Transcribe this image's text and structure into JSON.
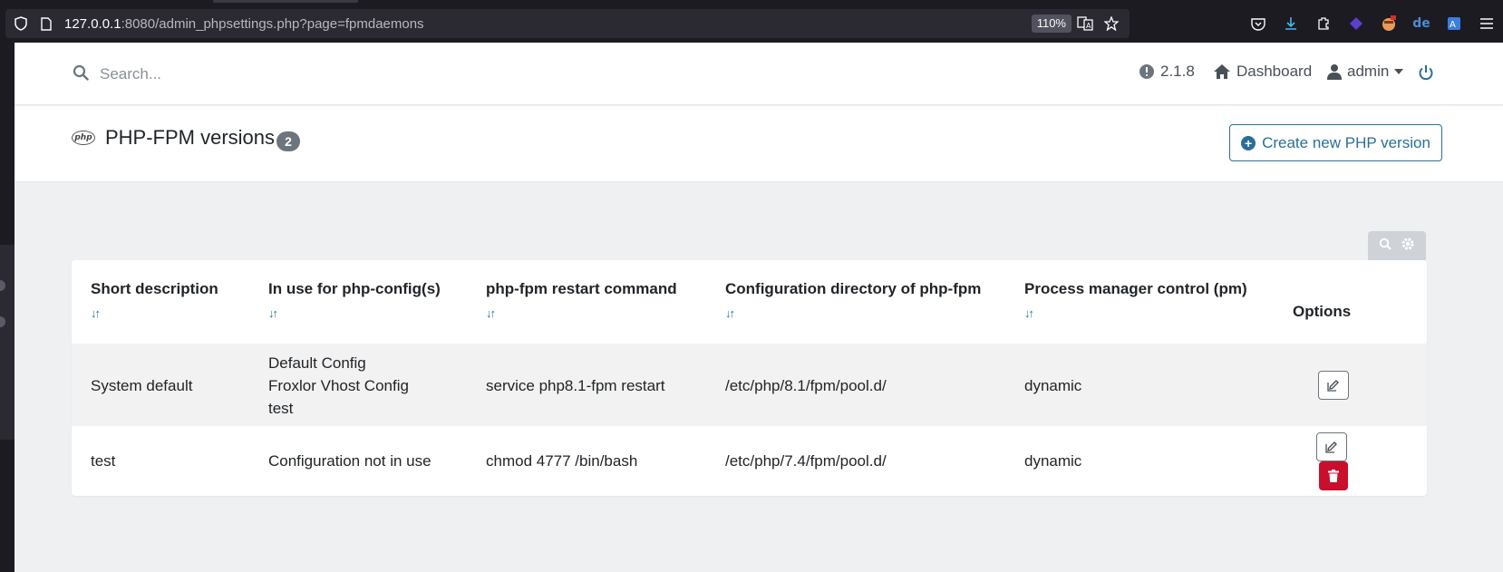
{
  "browser": {
    "url_host": "127.0.0.1",
    "url_rest": ":8080/admin_phpsettings.php?page=fpmdaemons",
    "zoom": "110%",
    "icons": [
      "shield-icon",
      "page-icon",
      "translate-icon",
      "bookmark-star-icon",
      "pocket-icon",
      "download-icon",
      "extensions-icon",
      "vpn-icon",
      "avatar-icon",
      "dict-de-icon",
      "translate-ext-icon",
      "menu-icon"
    ]
  },
  "nav": {
    "search_placeholder": "Search...",
    "version": "2.1.8",
    "dashboard": "Dashboard",
    "user": "admin"
  },
  "header": {
    "php_logo": "php",
    "title": "PHP-FPM versions",
    "count": "2",
    "create_button": "Create new PHP version"
  },
  "table": {
    "columns": [
      "Short description",
      "In use for php-config(s)",
      "php-fpm restart command",
      "Configuration directory of php-fpm",
      "Process manager control (pm)",
      "Options"
    ],
    "sort_glyph": "↓↑",
    "rows": [
      {
        "description": "System default",
        "configs": [
          "Default Config",
          "Froxlor Vhost Config",
          "test"
        ],
        "restart": "service php8.1-fpm restart",
        "dir": "/etc/php/8.1/fpm/pool.d/",
        "pm": "dynamic"
      },
      {
        "description": "test",
        "configs": [
          "Configuration not in use"
        ],
        "restart": "chmod 4777 /bin/bash",
        "dir": "/etc/php/7.4/fpm/pool.d/",
        "pm": "dynamic"
      }
    ]
  },
  "colors": {
    "accent": "#2a6f97",
    "danger": "#c8102e",
    "badge": "#6c757d"
  }
}
